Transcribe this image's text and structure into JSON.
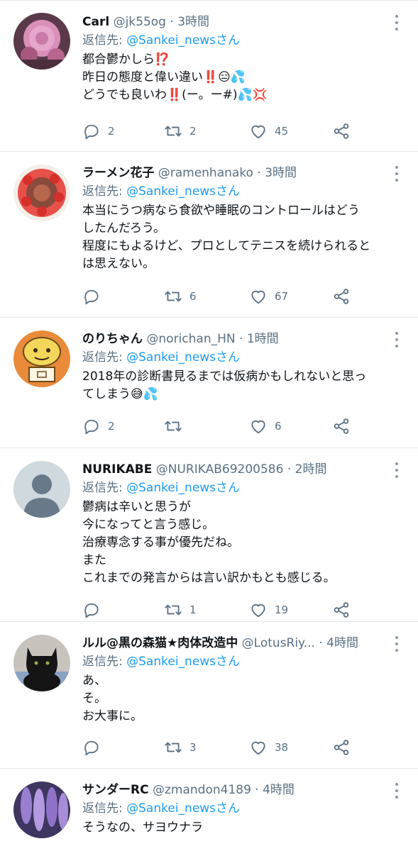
{
  "reply_prefix": "返信先: ",
  "tweets": [
    {
      "name": "Carl",
      "handle": "@jk55og",
      "sep": "·",
      "time": "3時間",
      "reply_to": "@Sankei_newsさん",
      "lines": [
        "都合鬱かしら⁉️",
        "昨日の態度と偉い違い‼️😑💦",
        "どうでも良いわ‼️(ー。ー#)💦💢"
      ],
      "replies": "2",
      "retweets": "2",
      "likes": "45",
      "avatar": "pink-flowers"
    },
    {
      "name": "ラーメン花子",
      "handle": "@ramenhanako",
      "sep": "·",
      "time": "3時間",
      "reply_to": "@Sankei_newsさん",
      "lines": [
        "本当にうつ病なら食欲や睡眠のコントロールはどう",
        "したんだろう。",
        "程度にもよるけど、プロとしてテニスを続けられると",
        "は思えない。"
      ],
      "replies": "",
      "retweets": "6",
      "likes": "67",
      "avatar": "strawberry-cake"
    },
    {
      "name": "のりちゃん",
      "handle": "@norichan_HN",
      "sep": "·",
      "time": "1時間",
      "reply_to": "@Sankei_newsさん",
      "lines": [
        "2018年の診断書見るまでは仮病かもしれないと思っ",
        "てしまう😅💦"
      ],
      "replies": "2",
      "retweets": "",
      "likes": "6",
      "avatar": "cartoon-face"
    },
    {
      "name": "NURIKABE",
      "handle": "@NURIKAB69200586",
      "sep": "·",
      "time": "2時間",
      "reply_to": "@Sankei_newsさん",
      "lines": [
        "鬱病は辛いと思うが",
        "今になってと言う感じ。",
        "治療専念する事が優先だね。",
        "また",
        "これまでの発言からは言い訳かもとも感じる。"
      ],
      "replies": "",
      "retweets": "1",
      "likes": "19",
      "avatar": "default-person"
    },
    {
      "name": "ルル@黒の森猫★肉体改造中",
      "handle": "@LotusRiy...",
      "sep": "·",
      "time": "4時間",
      "reply_to": "@Sankei_newsさん",
      "lines": [
        "あ、",
        "そ。",
        "お大事に。"
      ],
      "replies": "",
      "retweets": "3",
      "likes": "38",
      "avatar": "black-cat"
    },
    {
      "name": "サンダーRC",
      "handle": "@zmandon4189",
      "sep": "·",
      "time": "4時間",
      "reply_to": "@Sankei_newsさん",
      "lines": [
        "そうなの、サヨウナラ"
      ],
      "replies": "",
      "retweets": "",
      "likes": "",
      "avatar": "purple-wisteria"
    }
  ]
}
